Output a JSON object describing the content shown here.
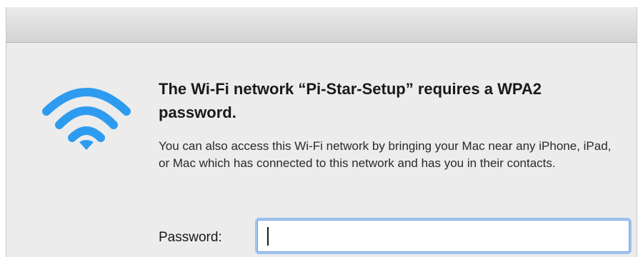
{
  "dialog": {
    "headline": "The Wi-Fi network “Pi-Star-Setup” requires a WPA2 password.",
    "body": "You can also access this Wi-Fi network by bringing your Mac near any iPhone, iPad, or Mac which has connected to this network and has you in their contacts.",
    "password_label": "Password:",
    "password_value": "",
    "icon": "wifi-icon",
    "accent_color": "#2d9cf0"
  }
}
